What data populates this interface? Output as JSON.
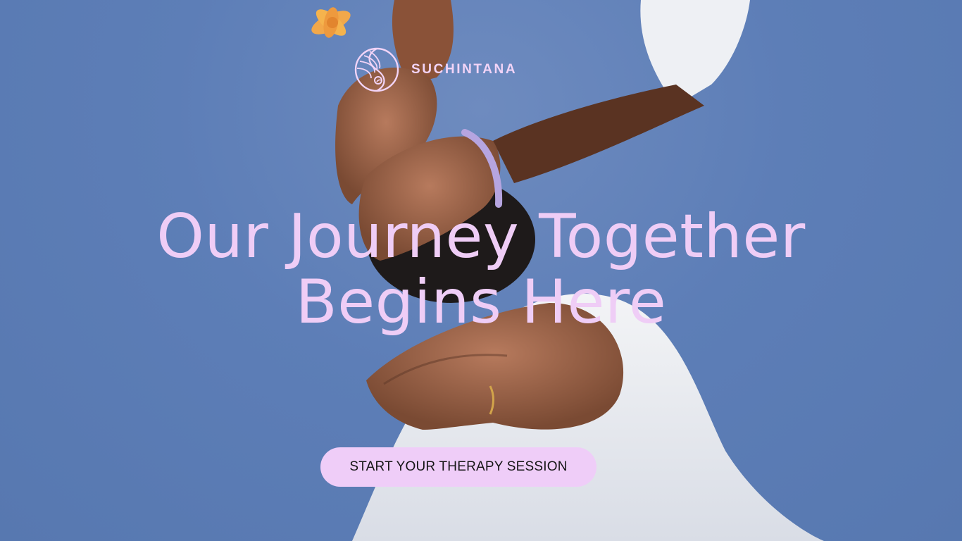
{
  "brand": {
    "name": "SUCHINTANA",
    "logo_icon": "yin-yang-wave-icon"
  },
  "hero": {
    "headline_line1": "Our Journey Together",
    "headline_line2": "Begins Here",
    "cta_label": "START YOUR THERAPY SESSION",
    "background_image": "person-reaching-hands-against-sky"
  },
  "colors": {
    "sky": "#5d7eb7",
    "accent_text": "#efcdf6",
    "button_bg": "#efcdf8",
    "button_text": "#151515"
  }
}
